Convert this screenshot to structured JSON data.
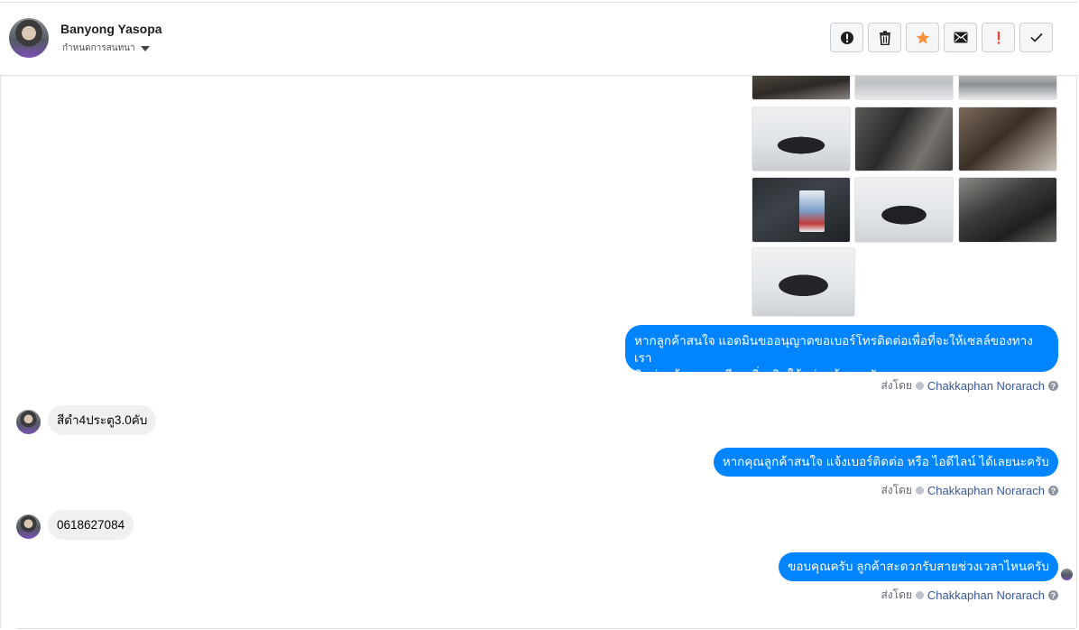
{
  "header": {
    "contact_name": "Banyong Yasopa",
    "label_dropdown": "กำหนดการสนทนา",
    "actions": [
      {
        "id": "spam",
        "icon": "alert-circle-icon"
      },
      {
        "id": "delete",
        "icon": "trash-icon"
      },
      {
        "id": "star",
        "icon": "star-icon",
        "color": "#f7923b"
      },
      {
        "id": "mark-unread",
        "icon": "envelope-icon"
      },
      {
        "id": "important",
        "icon": "exclamation-icon",
        "color": "#e4483e"
      },
      {
        "id": "done",
        "icon": "check-icon"
      }
    ]
  },
  "colors": {
    "outgoing_bubble": "#0084ff",
    "incoming_bubble": "#f1f0f0",
    "agent_link": "#385898"
  },
  "photos": [
    "interior",
    "truck-side",
    "door-panel",
    "seats",
    "manual-box",
    "truck-rear",
    "gear-shift",
    "truck-front"
  ],
  "messages": [
    {
      "direction": "out",
      "line1": "หากลูกค้าสนใจ แอดมินขออนุญาตขอเบอร์โทรติดต่อเพื่อที่จะให้เซลล์ของทางเรา",
      "line2": "ติดต่อแจ้งรายละเอียดเพิ่มเติมให้แก่ลูกค้านะครับ"
    },
    {
      "direction": "in",
      "text": "สีดำ4ประตู3.0คับ"
    },
    {
      "direction": "out",
      "text": "หากคุณลูกค้าสนใจ แจ้งเบอร์ติดต่อ หรือ ไอดีไลน์ ได้เลยนะครับ"
    },
    {
      "direction": "in",
      "text": "0618627084"
    },
    {
      "direction": "out",
      "text": "ขอบคุณครับ ลูกค้าสะดวกรับสายช่วงเวลาไหนครับ"
    }
  ],
  "sent_by": {
    "prefix": "ส่งโดย",
    "agent": "Chakkaphan Norarach",
    "help": "?"
  }
}
